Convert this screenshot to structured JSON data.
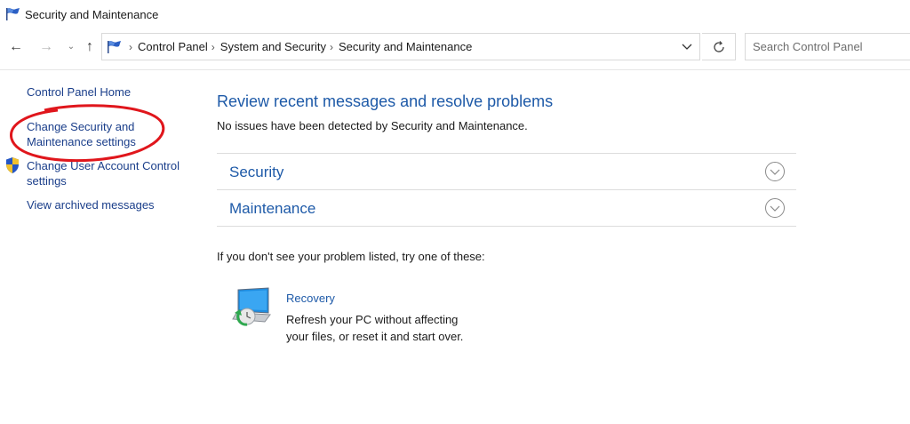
{
  "window": {
    "title": "Security and Maintenance",
    "icon": "control-panel-flag-icon"
  },
  "navigation": {
    "back_icon": "arrow-left-icon",
    "forward_icon": "arrow-right-icon",
    "recent_icon": "chevron-down-icon",
    "up_icon": "arrow-up-icon",
    "breadcrumbs": [
      "Control Panel",
      "System and Security",
      "Security and Maintenance"
    ],
    "refresh_icon": "refresh-icon",
    "search_placeholder": "Search Control Panel"
  },
  "sidebar": {
    "items": [
      {
        "label": "Control Panel Home"
      },
      {
        "label_line1": "Change Security and",
        "label_line2": "Maintenance settings",
        "highlighted": true
      },
      {
        "label_line1": "Change User Account Control",
        "label_line2": "settings",
        "icon": "uac-shield-icon"
      },
      {
        "label": "View archived messages"
      }
    ]
  },
  "main": {
    "title": "Review recent messages and resolve problems",
    "status": "No issues have been detected by Security and Maintenance.",
    "sections": [
      {
        "label": "Security",
        "expanded": false
      },
      {
        "label": "Maintenance",
        "expanded": false
      }
    ],
    "hint": "If you don't see your problem listed, try one of these:",
    "recovery": {
      "link": "Recovery",
      "description_line1": "Refresh your PC without affecting",
      "description_line2": "your files, or reset it and start over.",
      "icon": "recovery-pc-icon"
    }
  },
  "colors": {
    "link": "#1e5aa8",
    "annotation": "#e0161c",
    "border": "#d9d9d9"
  }
}
